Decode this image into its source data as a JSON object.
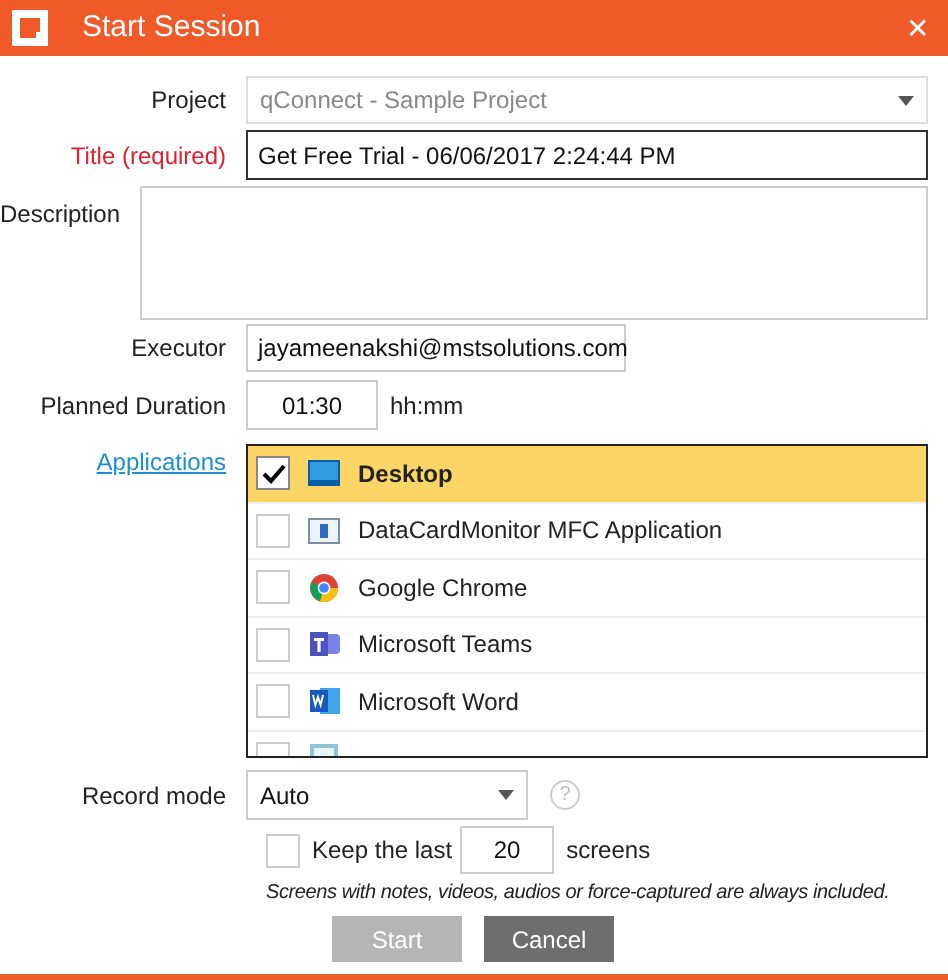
{
  "window": {
    "title": "Start Session",
    "close": "✕"
  },
  "project": {
    "label": "Project",
    "value": "qConnect - Sample Project"
  },
  "title_field": {
    "label": "Title (required)",
    "value": "Get Free Trial - 06/06/2017 2:24:44 PM"
  },
  "description": {
    "label": "Description"
  },
  "executor": {
    "label": "Executor",
    "value": "jayameenakshi@mstsolutions.com"
  },
  "duration": {
    "label": "Planned Duration",
    "value": "01:30",
    "unit": "hh:mm"
  },
  "applications": {
    "label": "Applications",
    "items": [
      {
        "kind": "desktop",
        "label": "Desktop",
        "checked": true,
        "selected": true
      },
      {
        "kind": "window",
        "label": "DataCardMonitor MFC Application",
        "checked": false,
        "selected": false
      },
      {
        "kind": "chrome",
        "label": "Google Chrome",
        "checked": false,
        "selected": false
      },
      {
        "kind": "teams",
        "label": "Microsoft Teams",
        "checked": false,
        "selected": false
      },
      {
        "kind": "word",
        "label": "Microsoft Word",
        "checked": false,
        "selected": false
      },
      {
        "kind": "notepad",
        "selected": false
      }
    ]
  },
  "record_mode": {
    "label": "Record mode",
    "value": "Auto",
    "help": "?"
  },
  "keep_last": {
    "checked": false,
    "prefix": "Keep the last",
    "value": "20",
    "suffix": "screens"
  },
  "note": "Screens with notes, videos, audios or force-captured are always included.",
  "buttons": [
    {
      "kind": "primary",
      "label": "Start",
      "disabled": true
    },
    {
      "kind": "secondary",
      "label": "Cancel",
      "disabled": false
    }
  ]
}
